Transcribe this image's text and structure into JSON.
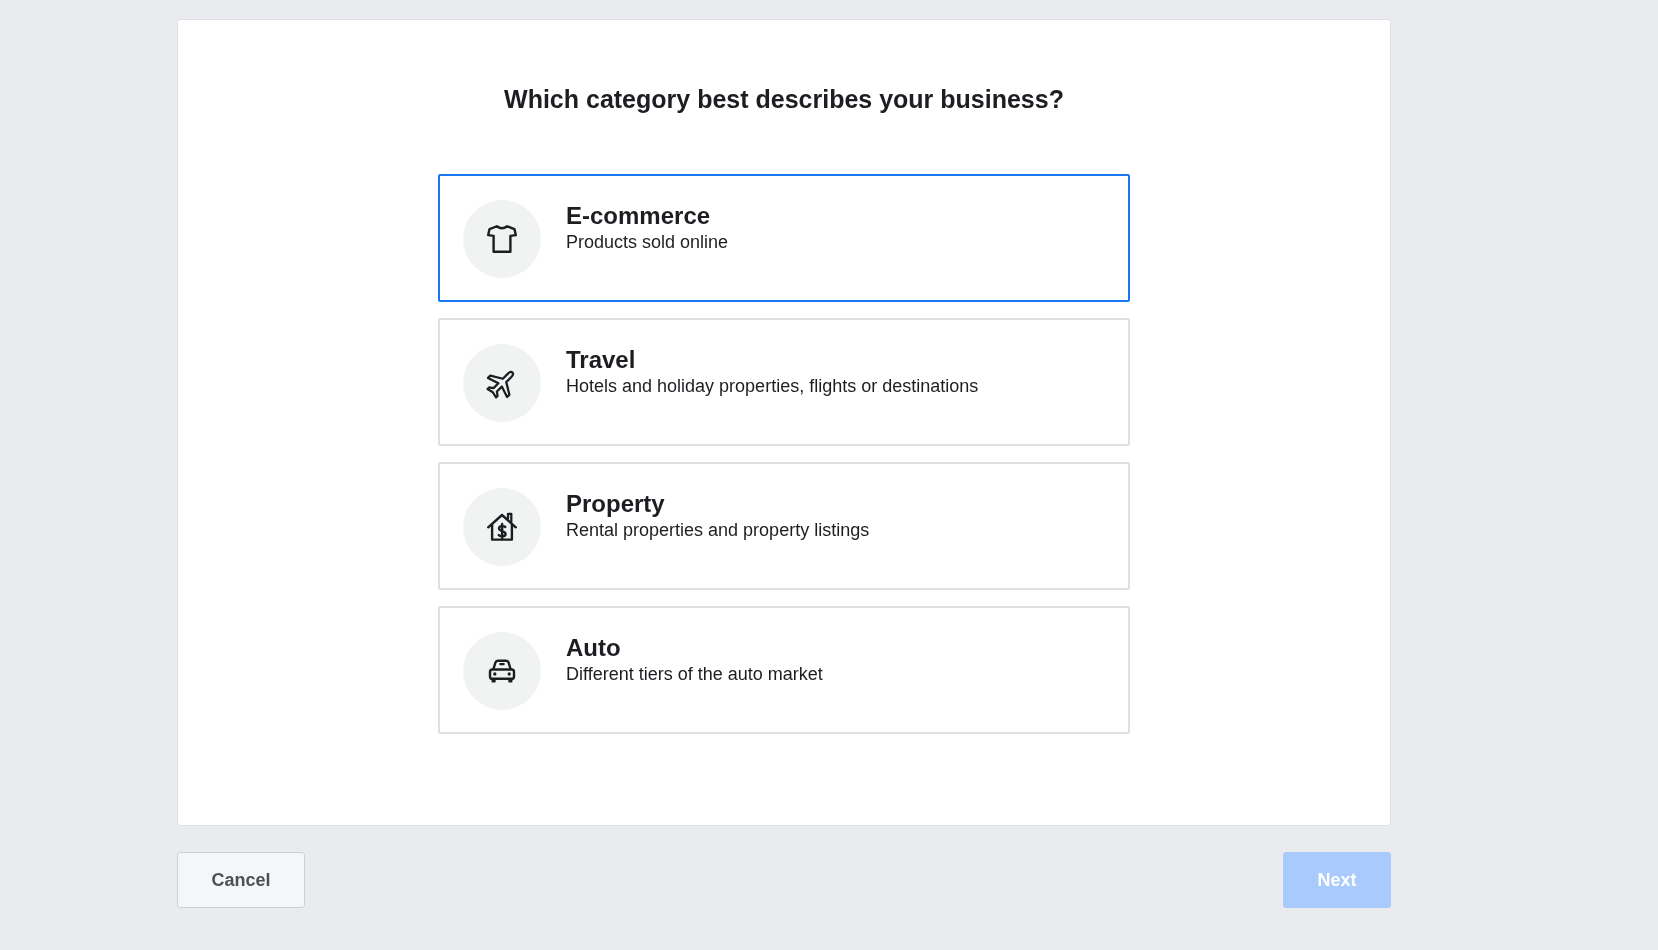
{
  "title": "Which category best describes your business?",
  "categories": [
    {
      "kind": "shirt",
      "title": "E-commerce",
      "description": "Products sold online",
      "selected": true
    },
    {
      "kind": "plane",
      "title": "Travel",
      "description": "Hotels and holiday properties, flights or destinations",
      "selected": false
    },
    {
      "kind": "house",
      "title": "Property",
      "description": "Rental properties and property listings",
      "selected": false
    },
    {
      "kind": "car",
      "title": "Auto",
      "description": "Different tiers of the auto market",
      "selected": false
    }
  ],
  "buttons": [
    {
      "kind": "cancel",
      "label": "Cancel",
      "disabled": false
    },
    {
      "kind": "next",
      "label": "Next",
      "disabled": true
    }
  ]
}
